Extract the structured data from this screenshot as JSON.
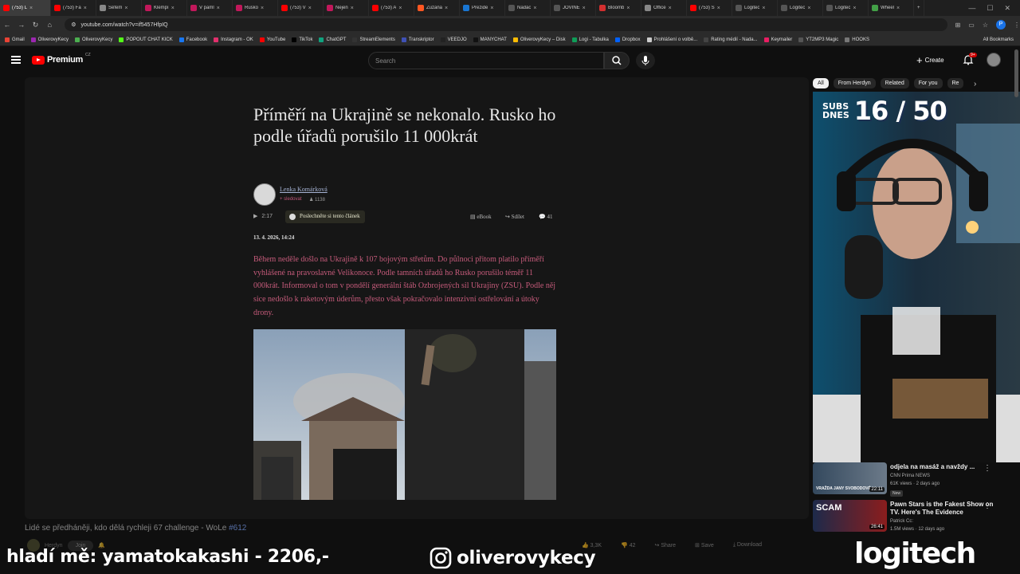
{
  "browser": {
    "tabs": [
      {
        "label": "(753) L",
        "active": true,
        "color": "#ff0000"
      },
      {
        "label": "(753) Fa",
        "color": "#ff0000"
      },
      {
        "label": "Šéfem",
        "color": "#888888"
      },
      {
        "label": "Klempí",
        "color": "#c2185b"
      },
      {
        "label": "V paml",
        "color": "#c2185b"
      },
      {
        "label": "Rusko",
        "color": "#c2185b"
      },
      {
        "label": "(753) V",
        "color": "#ff0000"
      },
      {
        "label": "Nejen",
        "color": "#c2185b"
      },
      {
        "label": "(753) A",
        "color": "#ff0000"
      },
      {
        "label": "Zuzana",
        "color": "#ff5722"
      },
      {
        "label": "Prezide",
        "color": "#1976d2"
      },
      {
        "label": "Nadác",
        "color": "#555555"
      },
      {
        "label": "JOVINE",
        "color": "#555555"
      },
      {
        "label": "Bloomb",
        "color": "#d32f2f"
      },
      {
        "label": "Office",
        "color": "#888888"
      },
      {
        "label": "(753) S",
        "color": "#ff0000"
      },
      {
        "label": "Logitec",
        "color": "#555555"
      },
      {
        "label": "Logitec",
        "color": "#555555"
      },
      {
        "label": "Logitec",
        "color": "#555555"
      },
      {
        "label": "Wheel",
        "color": "#43a047"
      }
    ],
    "url": "youtube.com/watch?v=if5457HfpIQ",
    "profile_initial": "P",
    "bookmarks": [
      {
        "label": "Gmail",
        "color": "#ea4335"
      },
      {
        "label": "OliverovyKecy",
        "color": "#9c27b0"
      },
      {
        "label": "OliverovyKecy",
        "color": "#4caf50"
      },
      {
        "label": "POPOUT CHAT KICK",
        "color": "#53fc18"
      },
      {
        "label": "Facebook",
        "color": "#1877f2"
      },
      {
        "label": "Instagram - OK",
        "color": "#e1306c"
      },
      {
        "label": "YouTube",
        "color": "#ff0000"
      },
      {
        "label": "TikTok",
        "color": "#000000"
      },
      {
        "label": "ChatGPT",
        "color": "#10a37f"
      },
      {
        "label": "StreamElements",
        "color": "#333333"
      },
      {
        "label": "Transkriptor",
        "color": "#3f51b5"
      },
      {
        "label": "VEEDJO",
        "color": "#222222"
      },
      {
        "label": "MANYCHAT",
        "color": "#111111"
      },
      {
        "label": "OliverovyKecy – Disk",
        "color": "#fbbc04"
      },
      {
        "label": "Logi - Tabulka",
        "color": "#0f9d58"
      },
      {
        "label": "Dropbox",
        "color": "#0061ff"
      },
      {
        "label": "Prohlášení o volbě...",
        "color": "#cccccc"
      },
      {
        "label": "Rating médií - Nada...",
        "color": "#444444"
      },
      {
        "label": "Keymailer",
        "color": "#e91e63"
      },
      {
        "label": "YT2MP3 Magic",
        "color": "#555555"
      },
      {
        "label": "HOOKS",
        "color": "#777777"
      }
    ],
    "all_bookmarks": "All Bookmarks"
  },
  "youtube": {
    "logo": "Premium",
    "logo_country": "CZ",
    "search_placeholder": "Search",
    "create_label": "Create",
    "notif_badge": "9+"
  },
  "article": {
    "title": "Příměří na Ukrajině se nekonalo. Rusko ho podle úřadů porušilo 11 000krát",
    "author": "Lenka Komárková",
    "follow": "+ sledovat",
    "followers": "1138",
    "duration": "2:17",
    "listen": "Poslechněte si tento článek",
    "ebook": "eBook",
    "share": "Sdílet",
    "comments": "41",
    "date": "13. 4. 2026, 14:24",
    "lead": "Během neděle došlo na Ukrajině k 107 bojovým střetům. Do půlnoci přitom platilo příměří vyhlášené na pravoslavné Velikonoce. Podle tamních úřadů ho Rusko porušilo téměř 11 000krát. Informoval o tom v pondělí generální štáb Ozbrojených sil Ukrajiny (ZSU). Podle něj sice nedošlo k raketovým úderům, přesto však pokračovalo intenzivní ostřelování a útoky drony."
  },
  "video": {
    "title": "Lidé se předháněji, kdo dělá rychleji 67 challenge - WoLe",
    "tag": "#612",
    "channel": "Herdyn",
    "join": "Join",
    "likes": "3,3K",
    "comments": "42",
    "share": "Share",
    "save": "Save",
    "download": "Download"
  },
  "chips": [
    "All",
    "From Herdyn",
    "Related",
    "For you",
    "Re"
  ],
  "stream": {
    "subs_label_1": "SUBS",
    "subs_label_2": "DNES",
    "subs_value": "16 / 50",
    "overlay_left": "hladí mě: yamatokakashi - 2206,-",
    "instagram": "oliverovykecy",
    "sponsor": "logitech"
  },
  "recommendations": [
    {
      "title": "odjela na masáž a navždy ...",
      "channel": "CNN Prima NEWS",
      "meta": "61K views · 2 days ago",
      "badge": "New",
      "duration": "22:11",
      "thumb_text": "VRAŽDA JANY SVOBODOVÉ"
    },
    {
      "title": "Pawn Stars is the Fakest Show on TV. Here's The Evidence",
      "channel": "Patrick Cc:",
      "meta": "1.5M views · 12 days ago",
      "badge": "",
      "duration": "26:41",
      "thumb_text": "SCAM"
    }
  ]
}
